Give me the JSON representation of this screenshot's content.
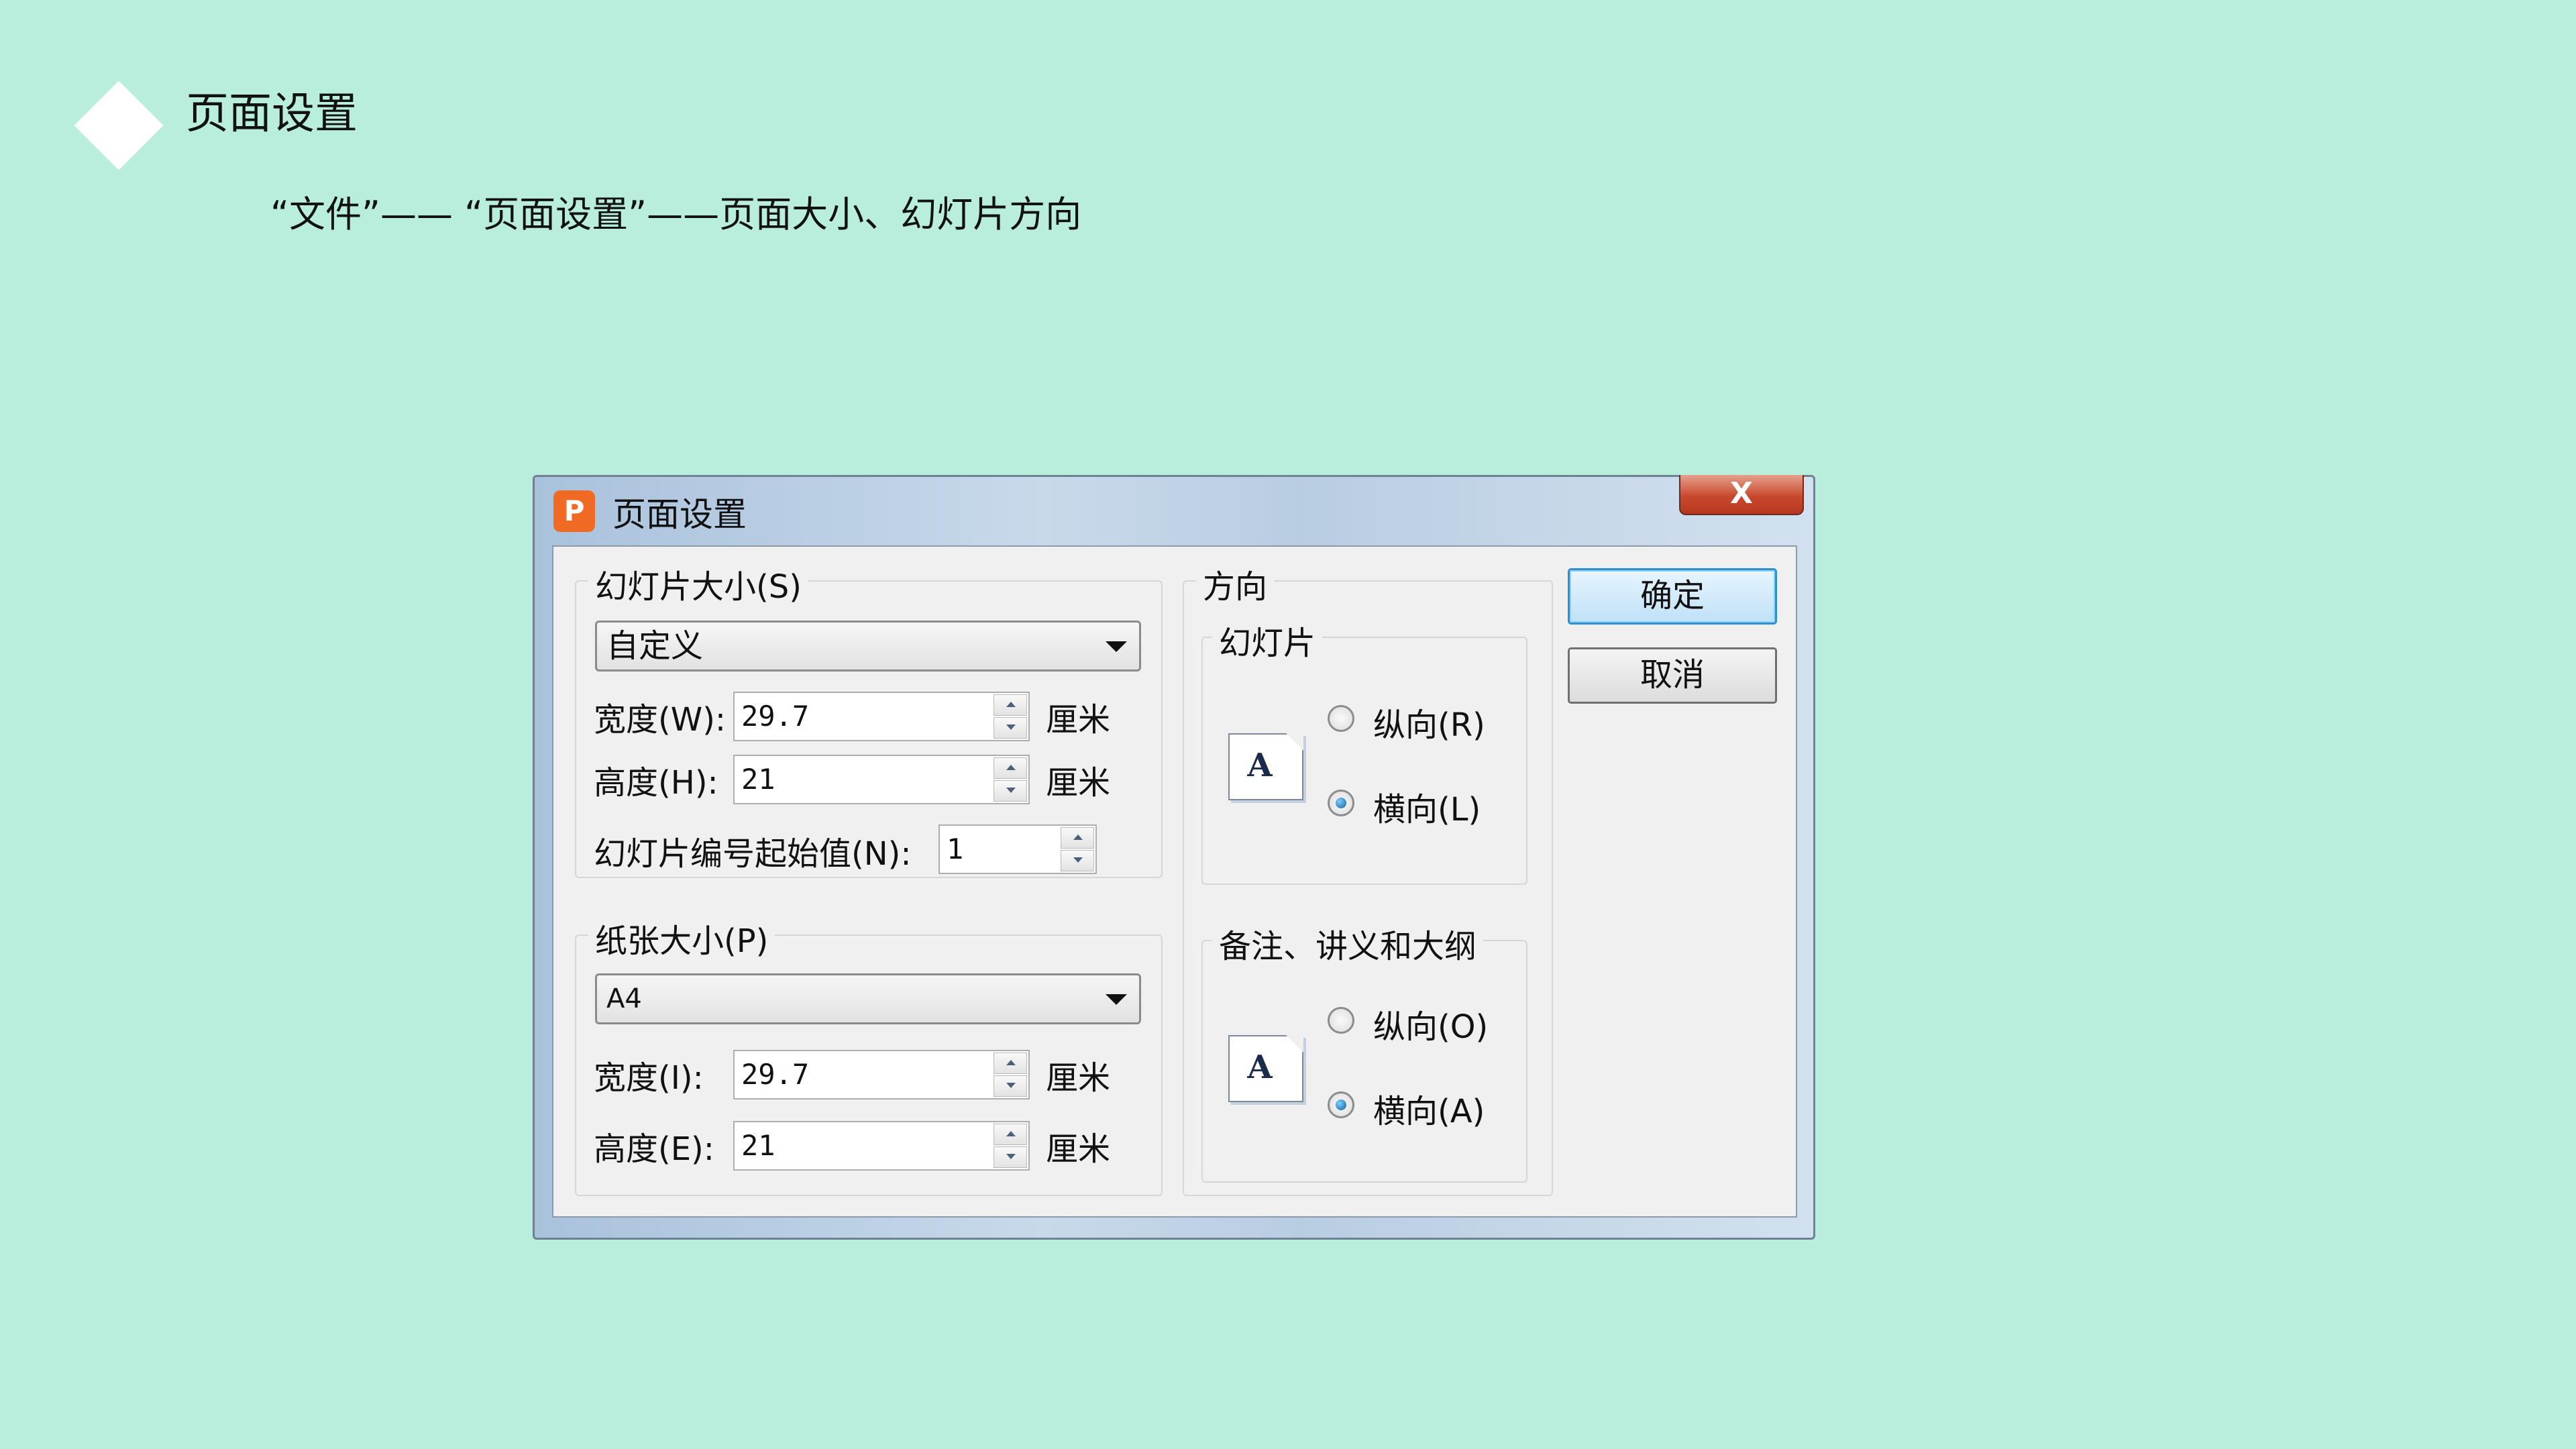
{
  "slide": {
    "title": "页面设置",
    "subtitle": "“文件”—— “页面设置”——页面大小、幻灯片方向"
  },
  "dialog": {
    "title": "页面设置",
    "app_icon": "wps-presentation-icon",
    "close_label": "X",
    "slide_size": {
      "legend": "幻灯片大小(S)",
      "selected": "自定义",
      "width_label": "宽度(W):",
      "width_value": "29.7",
      "height_label": "高度(H):",
      "height_value": "21",
      "unit": "厘米",
      "start_number_label": "幻灯片编号起始值(N):",
      "start_number_value": "1"
    },
    "paper_size": {
      "legend": "纸张大小(P)",
      "selected": "A4",
      "width_label": "宽度(I):",
      "width_value": "29.7",
      "height_label": "高度(E):",
      "height_value": "21",
      "unit": "厘米"
    },
    "orientation": {
      "legend": "方向",
      "slides": {
        "legend": "幻灯片",
        "icon_letter": "A",
        "portrait_label": "纵向(R)",
        "landscape_label": "横向(L)",
        "selected": "landscape"
      },
      "notes": {
        "legend": "备注、讲义和大纲",
        "icon_letter": "A",
        "portrait_label": "纵向(O)",
        "landscape_label": "横向(A)",
        "selected": "landscape"
      }
    },
    "buttons": {
      "ok": "确定",
      "cancel": "取消"
    }
  },
  "colors": {
    "background": "#b9eedc",
    "dialog_face": "#f0f0f0",
    "close_red": "#c9492f",
    "app_icon_orange": "#f06a24",
    "default_button_border": "#2c8fd1"
  }
}
